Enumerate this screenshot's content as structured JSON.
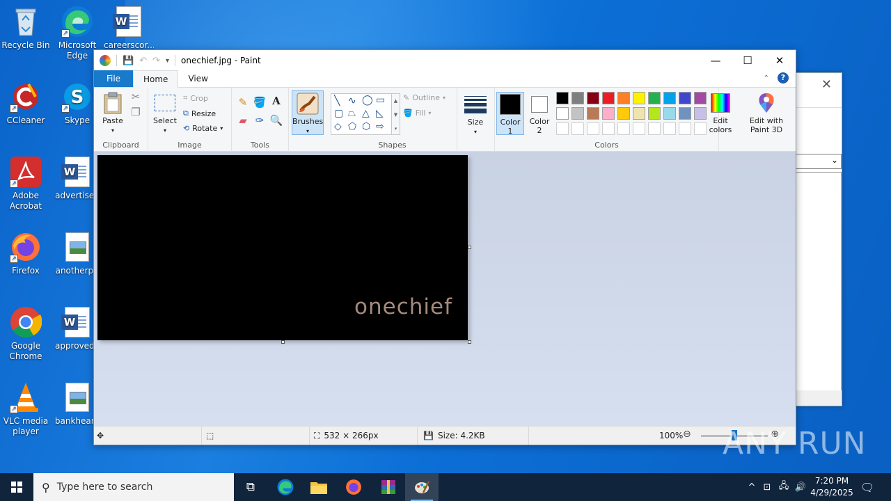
{
  "desktop": {
    "icons": [
      {
        "label": "Recycle Bin"
      },
      {
        "label": "Microsoft Edge"
      },
      {
        "label": "careerscor..."
      },
      {
        "label": "CCleaner"
      },
      {
        "label": "Skype"
      },
      {
        "label": "Adobe Acrobat"
      },
      {
        "label": "advertiseu"
      },
      {
        "label": "Firefox"
      },
      {
        "label": "anotherpri"
      },
      {
        "label": "Google Chrome"
      },
      {
        "label": "approvedo"
      },
      {
        "label": "VLC media player"
      },
      {
        "label": "bankheard"
      }
    ]
  },
  "paint": {
    "title": "onechief.jpg - Paint",
    "tabs": {
      "file": "File",
      "home": "Home",
      "view": "View"
    },
    "help": "?",
    "clipboard": {
      "paste": "Paste",
      "label": "Clipboard"
    },
    "image": {
      "select": "Select",
      "crop": "Crop",
      "resize": "Resize",
      "rotate": "Rotate",
      "label": "Image"
    },
    "tools": {
      "label": "Tools",
      "text_tool": "A"
    },
    "brushes": {
      "label": "Brushes"
    },
    "shapes": {
      "outline": "Outline",
      "fill": "Fill",
      "label": "Shapes"
    },
    "size": {
      "label": "Size"
    },
    "colors": {
      "color1": "Color 1",
      "color2": "Color 2",
      "edit_colors": "Edit colors",
      "label": "Colors",
      "color1_value": "#000000",
      "color2_value": "#ffffff",
      "palette_row1": [
        "#000000",
        "#7f7f7f",
        "#880015",
        "#ed1c24",
        "#ff7f27",
        "#fff200",
        "#22b14c",
        "#00a2e8",
        "#3f48cc",
        "#a349a4"
      ],
      "palette_row2": [
        "#ffffff",
        "#c3c3c3",
        "#b97a57",
        "#ffaec9",
        "#ffc90e",
        "#efe4b0",
        "#b5e61d",
        "#99d9ea",
        "#7092be",
        "#c8bfe7"
      ]
    },
    "edit3d": {
      "label": "Edit with Paint 3D"
    },
    "canvas": {
      "text": "onechief",
      "background": "#000000",
      "text_color": "#a58a7c"
    },
    "status": {
      "dimensions": "532 × 266px",
      "size": "Size: 4.2KB",
      "zoom": "100%",
      "zoom_value": 100
    }
  },
  "watermark": "ANY RUN",
  "taskbar": {
    "search_placeholder": "Type here to search",
    "time": "7:20 PM",
    "date": "4/29/2025"
  }
}
